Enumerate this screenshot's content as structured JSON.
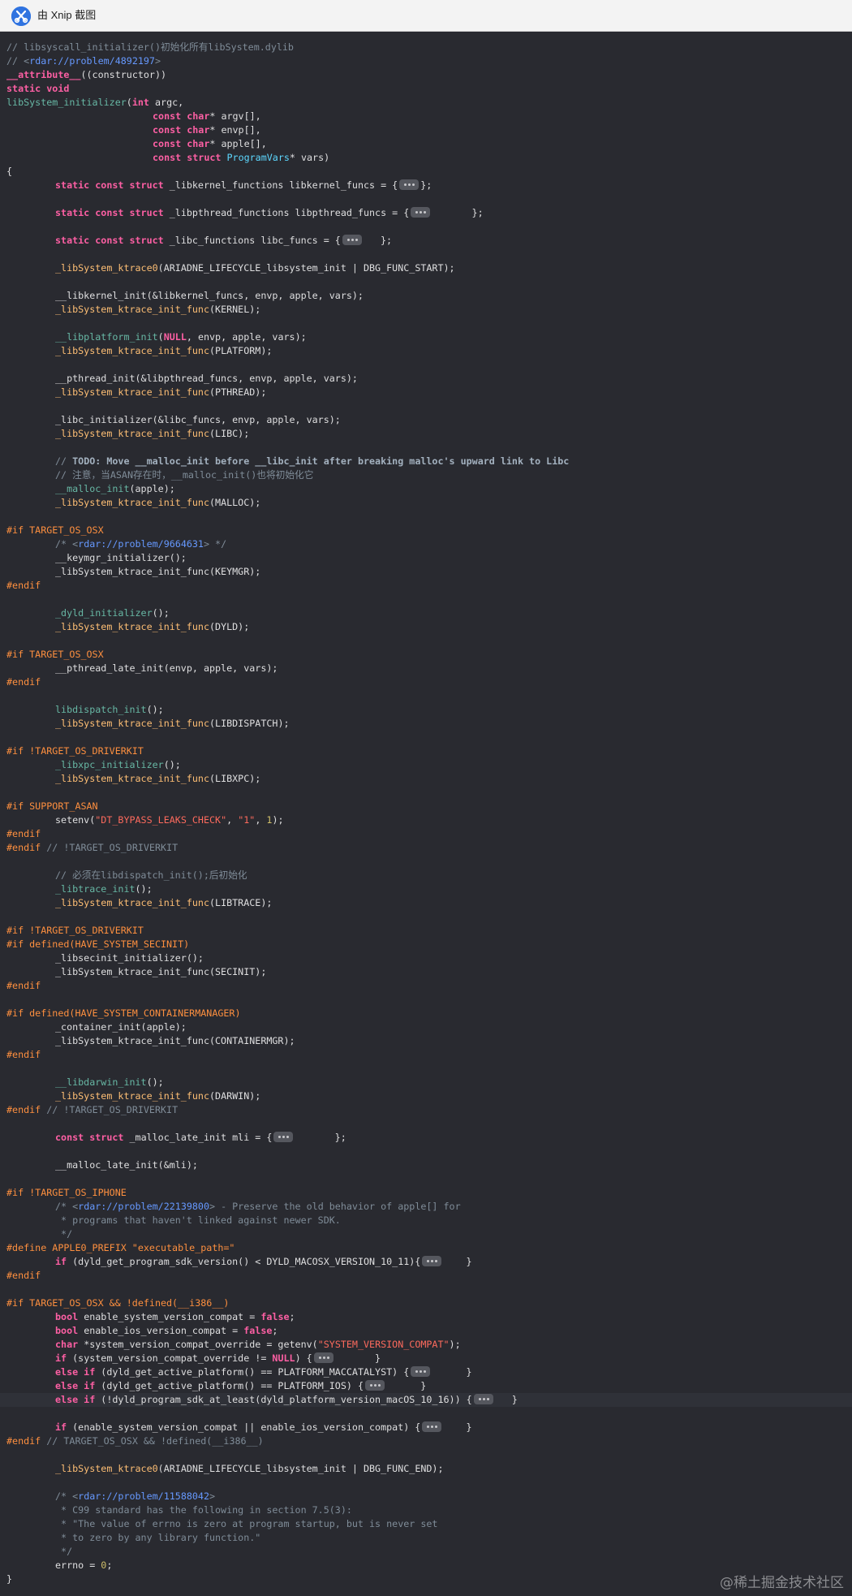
{
  "window": {
    "title": "由 Xnip 截图",
    "icon": "scissors-icon",
    "highlight_color": "#2f3138",
    "background": "#292a30"
  },
  "watermark": "@稀土掘金技术社区",
  "code": {
    "lines": [
      {
        "i": 0,
        "t": [
          [
            "cm",
            "// libsyscall_initializer()初始化所有libSystem.dylib"
          ]
        ]
      },
      {
        "i": 0,
        "t": [
          [
            "cm",
            "// <"
          ],
          [
            "url",
            "rdar://problem/4892197"
          ],
          [
            "cm",
            ">"
          ]
        ]
      },
      {
        "i": 0,
        "t": [
          [
            "kw",
            "__attribute__"
          ],
          [
            "",
            "((constructor))"
          ]
        ]
      },
      {
        "i": 0,
        "t": [
          [
            "kw",
            "static void"
          ]
        ]
      },
      {
        "i": 0,
        "t": [
          [
            "fn",
            "libSystem_initializer"
          ],
          [
            "",
            "("
          ],
          [
            "kw",
            "int"
          ],
          [
            "",
            " argc,"
          ]
        ]
      },
      {
        "i": 24,
        "t": [
          [
            "kw",
            "const char"
          ],
          [
            "",
            "* argv[],"
          ]
        ]
      },
      {
        "i": 24,
        "t": [
          [
            "kw",
            "const char"
          ],
          [
            "",
            "* envp[],"
          ]
        ]
      },
      {
        "i": 24,
        "t": [
          [
            "kw",
            "const char"
          ],
          [
            "",
            "* apple[],"
          ]
        ]
      },
      {
        "i": 24,
        "t": [
          [
            "kw",
            "const struct"
          ],
          [
            "",
            " "
          ],
          [
            "ty",
            "ProgramVars"
          ],
          [
            "",
            "* vars)"
          ]
        ]
      },
      {
        "i": 0,
        "t": [
          [
            "",
            "{"
          ]
        ]
      },
      {
        "i": 8,
        "t": [
          [
            "kw",
            "static const struct"
          ],
          [
            "",
            " _libkernel_functions libkernel_funcs = {"
          ],
          [
            "fold",
            ""
          ],
          [
            "",
            "};"
          ]
        ]
      },
      {
        "i": 0,
        "t": []
      },
      {
        "i": 8,
        "t": [
          [
            "kw",
            "static const struct"
          ],
          [
            "",
            " _libpthread_functions libpthread_funcs = {"
          ],
          [
            "fold",
            ""
          ],
          [
            "",
            "       };"
          ]
        ]
      },
      {
        "i": 0,
        "t": []
      },
      {
        "i": 8,
        "t": [
          [
            "kw",
            "static const struct"
          ],
          [
            "",
            " _libc_functions libc_funcs = {"
          ],
          [
            "fold",
            ""
          ],
          [
            "",
            "   };"
          ]
        ]
      },
      {
        "i": 0,
        "t": []
      },
      {
        "i": 8,
        "t": [
          [
            "fy",
            "_libSystem_ktrace0"
          ],
          [
            "",
            "(ARIADNE_LIFECYCLE_libsystem_init | DBG_FUNC_START);"
          ]
        ]
      },
      {
        "i": 0,
        "t": []
      },
      {
        "i": 8,
        "t": [
          [
            "",
            "__libkernel_init(&libkernel_funcs, envp, apple, vars);"
          ]
        ]
      },
      {
        "i": 8,
        "t": [
          [
            "fy",
            "_libSystem_ktrace_init_func"
          ],
          [
            "",
            "(KERNEL);"
          ]
        ]
      },
      {
        "i": 0,
        "t": []
      },
      {
        "i": 8,
        "t": [
          [
            "fn",
            "__libplatform_init"
          ],
          [
            "",
            "("
          ],
          [
            "kw",
            "NULL"
          ],
          [
            "",
            ", envp, apple, vars);"
          ]
        ]
      },
      {
        "i": 8,
        "t": [
          [
            "fy",
            "_libSystem_ktrace_init_func"
          ],
          [
            "",
            "(PLATFORM);"
          ]
        ]
      },
      {
        "i": 0,
        "t": []
      },
      {
        "i": 8,
        "t": [
          [
            "",
            "__pthread_init(&libpthread_funcs, envp, apple, vars);"
          ]
        ]
      },
      {
        "i": 8,
        "t": [
          [
            "fy",
            "_libSystem_ktrace_init_func"
          ],
          [
            "",
            "(PTHREAD);"
          ]
        ]
      },
      {
        "i": 0,
        "t": []
      },
      {
        "i": 8,
        "t": [
          [
            "",
            "_libc_initializer(&libc_funcs, envp, apple, vars);"
          ]
        ]
      },
      {
        "i": 8,
        "t": [
          [
            "fy",
            "_libSystem_ktrace_init_func"
          ],
          [
            "",
            "(LIBC);"
          ]
        ]
      },
      {
        "i": 0,
        "t": []
      },
      {
        "i": 8,
        "t": [
          [
            "cm",
            "// "
          ],
          [
            "td",
            "TODO: Move __malloc_init before __libc_init after breaking malloc's upward link to Libc"
          ]
        ]
      },
      {
        "i": 8,
        "t": [
          [
            "cm",
            "// 注意，当ASAN存在时，__malloc_init()也将初始化它"
          ]
        ]
      },
      {
        "i": 8,
        "t": [
          [
            "fn",
            "__malloc_init"
          ],
          [
            "",
            "(apple);"
          ]
        ]
      },
      {
        "i": 8,
        "t": [
          [
            "fy",
            "_libSystem_ktrace_init_func"
          ],
          [
            "",
            "(MALLOC);"
          ]
        ]
      },
      {
        "i": 0,
        "t": []
      },
      {
        "i": 0,
        "t": [
          [
            "pp",
            "#if TARGET_OS_OSX"
          ]
        ]
      },
      {
        "i": 8,
        "t": [
          [
            "cm",
            "/* <"
          ],
          [
            "url",
            "rdar://problem/9664631"
          ],
          [
            "cm",
            "> */"
          ]
        ]
      },
      {
        "i": 8,
        "t": [
          [
            "",
            "__keymgr_initializer();"
          ]
        ]
      },
      {
        "i": 8,
        "t": [
          [
            "",
            "_libSystem_ktrace_init_func(KEYMGR);"
          ]
        ]
      },
      {
        "i": 0,
        "t": [
          [
            "pp",
            "#endif"
          ]
        ]
      },
      {
        "i": 0,
        "t": []
      },
      {
        "i": 8,
        "t": [
          [
            "fn",
            "_dyld_initializer"
          ],
          [
            "",
            "();"
          ]
        ]
      },
      {
        "i": 8,
        "t": [
          [
            "fy",
            "_libSystem_ktrace_init_func"
          ],
          [
            "",
            "(DYLD);"
          ]
        ]
      },
      {
        "i": 0,
        "t": []
      },
      {
        "i": 0,
        "t": [
          [
            "pp",
            "#if TARGET_OS_OSX"
          ]
        ]
      },
      {
        "i": 8,
        "t": [
          [
            "",
            "__pthread_late_init(envp, apple, vars);"
          ]
        ]
      },
      {
        "i": 0,
        "t": [
          [
            "pp",
            "#endif"
          ]
        ]
      },
      {
        "i": 0,
        "t": []
      },
      {
        "i": 8,
        "t": [
          [
            "fn",
            "libdispatch_init"
          ],
          [
            "",
            "();"
          ]
        ]
      },
      {
        "i": 8,
        "t": [
          [
            "fy",
            "_libSystem_ktrace_init_func"
          ],
          [
            "",
            "(LIBDISPATCH);"
          ]
        ]
      },
      {
        "i": 0,
        "t": []
      },
      {
        "i": 0,
        "t": [
          [
            "pp",
            "#if !TARGET_OS_DRIVERKIT"
          ]
        ]
      },
      {
        "i": 8,
        "t": [
          [
            "fn",
            "_libxpc_initializer"
          ],
          [
            "",
            "();"
          ]
        ]
      },
      {
        "i": 8,
        "t": [
          [
            "fy",
            "_libSystem_ktrace_init_func"
          ],
          [
            "",
            "(LIBXPC);"
          ]
        ]
      },
      {
        "i": 0,
        "t": []
      },
      {
        "i": 0,
        "t": [
          [
            "pp",
            "#if SUPPORT_ASAN"
          ]
        ]
      },
      {
        "i": 8,
        "t": [
          [
            "",
            "setenv("
          ],
          [
            "st",
            "\"DT_BYPASS_LEAKS_CHECK\""
          ],
          [
            "",
            ", "
          ],
          [
            "st",
            "\"1\""
          ],
          [
            "",
            ", "
          ],
          [
            "nm",
            "1"
          ],
          [
            "",
            ");"
          ]
        ]
      },
      {
        "i": 0,
        "t": [
          [
            "pp",
            "#endif"
          ]
        ]
      },
      {
        "i": 0,
        "t": [
          [
            "pp",
            "#endif"
          ],
          [
            "cm",
            " // !TARGET_OS_DRIVERKIT"
          ]
        ]
      },
      {
        "i": 0,
        "t": []
      },
      {
        "i": 8,
        "t": [
          [
            "cm",
            "// 必须在libdispatch_init();后初始化"
          ]
        ]
      },
      {
        "i": 8,
        "t": [
          [
            "fn",
            "_libtrace_init"
          ],
          [
            "",
            "();"
          ]
        ]
      },
      {
        "i": 8,
        "t": [
          [
            "fy",
            "_libSystem_ktrace_init_func"
          ],
          [
            "",
            "(LIBTRACE);"
          ]
        ]
      },
      {
        "i": 0,
        "t": []
      },
      {
        "i": 0,
        "t": [
          [
            "pp",
            "#if !TARGET_OS_DRIVERKIT"
          ]
        ]
      },
      {
        "i": 0,
        "t": [
          [
            "pp",
            "#if defined(HAVE_SYSTEM_SECINIT)"
          ]
        ]
      },
      {
        "i": 8,
        "t": [
          [
            "",
            "_libsecinit_initializer();"
          ]
        ]
      },
      {
        "i": 8,
        "t": [
          [
            "",
            "_libSystem_ktrace_init_func(SECINIT);"
          ]
        ]
      },
      {
        "i": 0,
        "t": [
          [
            "pp",
            "#endif"
          ]
        ]
      },
      {
        "i": 0,
        "t": []
      },
      {
        "i": 0,
        "t": [
          [
            "pp",
            "#if defined(HAVE_SYSTEM_CONTAINERMANAGER)"
          ]
        ]
      },
      {
        "i": 8,
        "t": [
          [
            "",
            "_container_init(apple);"
          ]
        ]
      },
      {
        "i": 8,
        "t": [
          [
            "",
            "_libSystem_ktrace_init_func(CONTAINERMGR);"
          ]
        ]
      },
      {
        "i": 0,
        "t": [
          [
            "pp",
            "#endif"
          ]
        ]
      },
      {
        "i": 0,
        "t": []
      },
      {
        "i": 8,
        "t": [
          [
            "fn",
            "__libdarwin_init"
          ],
          [
            "",
            "();"
          ]
        ]
      },
      {
        "i": 8,
        "t": [
          [
            "fy",
            "_libSystem_ktrace_init_func"
          ],
          [
            "",
            "(DARWIN);"
          ]
        ]
      },
      {
        "i": 0,
        "t": [
          [
            "pp",
            "#endif"
          ],
          [
            "cm",
            " // !TARGET_OS_DRIVERKIT"
          ]
        ]
      },
      {
        "i": 0,
        "t": []
      },
      {
        "i": 8,
        "t": [
          [
            "kw",
            "const struct"
          ],
          [
            "",
            " _malloc_late_init mli = {"
          ],
          [
            "fold",
            ""
          ],
          [
            "",
            "       };"
          ]
        ]
      },
      {
        "i": 0,
        "t": []
      },
      {
        "i": 8,
        "t": [
          [
            "",
            "__malloc_late_init(&mli);"
          ]
        ]
      },
      {
        "i": 0,
        "t": []
      },
      {
        "i": 0,
        "t": [
          [
            "pp",
            "#if !TARGET_OS_IPHONE"
          ]
        ]
      },
      {
        "i": 8,
        "t": [
          [
            "cm",
            "/* <"
          ],
          [
            "url",
            "rdar://problem/22139800"
          ],
          [
            "cm",
            "> - Preserve the old behavior of apple[] for"
          ]
        ]
      },
      {
        "i": 8,
        "t": [
          [
            "cm",
            " * programs that haven't linked against newer SDK."
          ]
        ]
      },
      {
        "i": 8,
        "t": [
          [
            "cm",
            " */"
          ]
        ]
      },
      {
        "i": 0,
        "t": [
          [
            "pp",
            "#define APPLE0_PREFIX \"executable_path=\""
          ]
        ]
      },
      {
        "i": 8,
        "t": [
          [
            "kw",
            "if"
          ],
          [
            "",
            " (dyld_get_program_sdk_version() < DYLD_MACOSX_VERSION_10_11){"
          ],
          [
            "fold",
            ""
          ],
          [
            "",
            "    }"
          ]
        ]
      },
      {
        "i": 0,
        "t": [
          [
            "pp",
            "#endif"
          ]
        ]
      },
      {
        "i": 0,
        "t": []
      },
      {
        "i": 0,
        "t": [
          [
            "pp",
            "#if TARGET_OS_OSX && !defined(__i386__)"
          ]
        ]
      },
      {
        "i": 8,
        "t": [
          [
            "kw",
            "bool"
          ],
          [
            "",
            " enable_system_version_compat = "
          ],
          [
            "kw",
            "false"
          ],
          [
            "",
            ";"
          ]
        ]
      },
      {
        "i": 8,
        "t": [
          [
            "kw",
            "bool"
          ],
          [
            "",
            " enable_ios_version_compat = "
          ],
          [
            "kw",
            "false"
          ],
          [
            "",
            ";"
          ]
        ]
      },
      {
        "i": 8,
        "t": [
          [
            "kw",
            "char"
          ],
          [
            "",
            " *system_version_compat_override = getenv("
          ],
          [
            "st",
            "\"SYSTEM_VERSION_COMPAT\""
          ],
          [
            "",
            ");"
          ]
        ]
      },
      {
        "i": 8,
        "t": [
          [
            "kw",
            "if"
          ],
          [
            "",
            " (system_version_compat_override != "
          ],
          [
            "kw",
            "NULL"
          ],
          [
            "",
            ") {"
          ],
          [
            "fold",
            ""
          ],
          [
            "",
            "       }"
          ]
        ]
      },
      {
        "i": 8,
        "t": [
          [
            "kw",
            "else if"
          ],
          [
            "",
            " (dyld_get_active_platform() == PLATFORM_MACCATALYST) {"
          ],
          [
            "fold",
            ""
          ],
          [
            "",
            "      }"
          ]
        ]
      },
      {
        "i": 8,
        "t": [
          [
            "kw",
            "else if"
          ],
          [
            "",
            " (dyld_get_active_platform() == PLATFORM_IOS) {"
          ],
          [
            "fold",
            ""
          ],
          [
            "",
            "      }"
          ]
        ]
      },
      {
        "i": 8,
        "hl": true,
        "t": [
          [
            "kw",
            "else if"
          ],
          [
            "",
            " (!dyld_program_sdk_at_least(dyld_platform_version_macOS_10_16)) {"
          ],
          [
            "fold",
            ""
          ],
          [
            "",
            "   }"
          ]
        ]
      },
      {
        "i": 0,
        "t": []
      },
      {
        "i": 8,
        "t": [
          [
            "kw",
            "if"
          ],
          [
            "",
            " (enable_system_version_compat || enable_ios_version_compat) {"
          ],
          [
            "fold",
            ""
          ],
          [
            "",
            "    }"
          ]
        ]
      },
      {
        "i": 0,
        "t": [
          [
            "pp",
            "#endif"
          ],
          [
            "cm",
            " // TARGET_OS_OSX && !defined(__i386__)"
          ]
        ]
      },
      {
        "i": 0,
        "t": []
      },
      {
        "i": 8,
        "t": [
          [
            "fy",
            "_libSystem_ktrace0"
          ],
          [
            "",
            "(ARIADNE_LIFECYCLE_libsystem_init | DBG_FUNC_END);"
          ]
        ]
      },
      {
        "i": 0,
        "t": []
      },
      {
        "i": 8,
        "t": [
          [
            "cm",
            "/* <"
          ],
          [
            "url",
            "rdar://problem/11588042"
          ],
          [
            "cm",
            ">"
          ]
        ]
      },
      {
        "i": 8,
        "t": [
          [
            "cm",
            " * C99 standard has the following in section 7.5(3):"
          ]
        ]
      },
      {
        "i": 8,
        "t": [
          [
            "cm",
            " * \"The value of errno is zero at program startup, but is never set"
          ]
        ]
      },
      {
        "i": 8,
        "t": [
          [
            "cm",
            " * to zero by any library function.\""
          ]
        ]
      },
      {
        "i": 8,
        "t": [
          [
            "cm",
            " */"
          ]
        ]
      },
      {
        "i": 8,
        "t": [
          [
            "",
            "errno = "
          ],
          [
            "nm",
            "0"
          ],
          [
            "",
            ";"
          ]
        ]
      },
      {
        "i": 0,
        "t": [
          [
            "",
            "}"
          ]
        ]
      }
    ]
  }
}
